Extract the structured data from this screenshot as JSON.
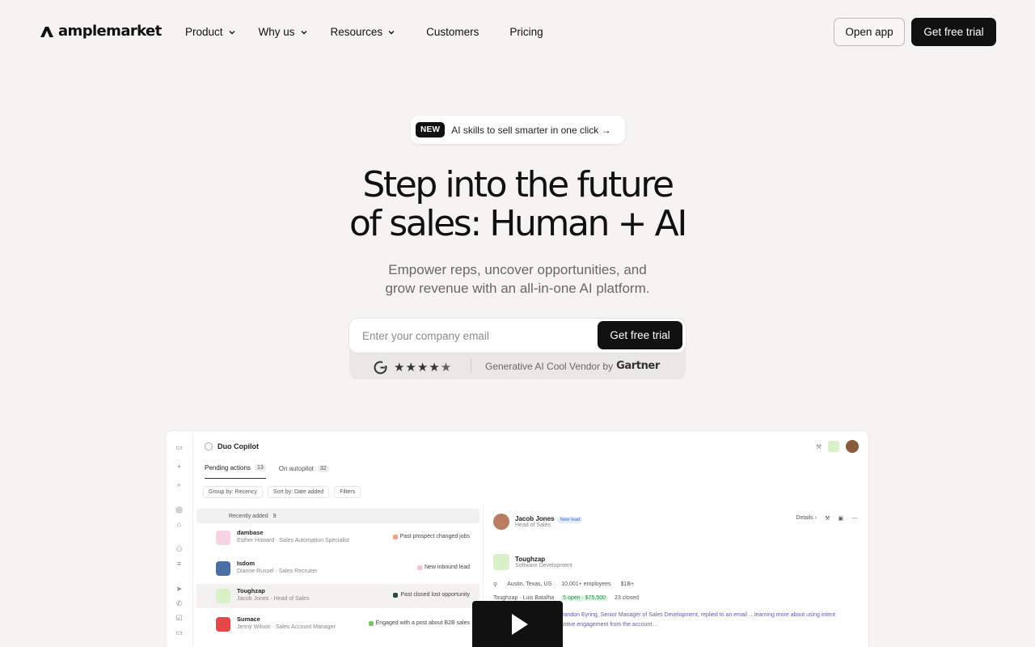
{
  "nav": {
    "logo_text": "amplemarket",
    "items": [
      {
        "label": "Product",
        "has_dropdown": true
      },
      {
        "label": "Why us",
        "has_dropdown": true
      },
      {
        "label": "Resources",
        "has_dropdown": true
      },
      {
        "label": "Customers",
        "has_dropdown": false
      },
      {
        "label": "Pricing",
        "has_dropdown": false
      }
    ],
    "open_app_label": "Open app",
    "trial_label": "Get free trial"
  },
  "announcement": {
    "badge": "NEW",
    "text": "AI skills to sell smarter in one click →"
  },
  "hero": {
    "title_line1": "Step into the future",
    "title_line2": "of sales: Human + AI",
    "subtitle_line1": "Empower reps, uncover opportunities, and",
    "subtitle_line2": "grow revenue with an all-in-one AI platform."
  },
  "signup": {
    "email_placeholder": "Enter your company email",
    "email_value": "",
    "submit_label": "Get free trial",
    "rating_stars": 4.5,
    "award_text": "Generative AI Cool Vendor by",
    "award_brand": "Gartner"
  },
  "app_preview": {
    "title": "Duo Copilot",
    "tabs": [
      {
        "label": "Pending actions",
        "count": "13"
      },
      {
        "label": "On autopilot",
        "count": "32"
      }
    ],
    "filters": [
      "Group by: Recency",
      "Sort by: Date added",
      "Filters"
    ],
    "group_label": "Recently added",
    "group_count": "9",
    "rows": [
      {
        "name": "dambase",
        "desc": "Esther Howard · Sales Automation Specialist",
        "event": "Past prospect changed jobs",
        "color": "#f3a48a"
      },
      {
        "name": "Isdom",
        "desc": "Dianne Russel · Sales Recruiter",
        "event": "New inbound lead",
        "color": "#f6c3cf"
      },
      {
        "name": "Toughzap",
        "desc": "Jacob Jones · Head of Sales",
        "event": "Past closed lost opportunity",
        "color": "#2b4d3a"
      },
      {
        "name": "Sumace",
        "desc": "Jenny Wilson · Sales Account Manager",
        "event": "Engaged with a post about B2B sales",
        "color": "#7cc36b"
      }
    ],
    "detail": {
      "person_name": "Jacob Jones",
      "person_badge": "New lead",
      "person_role": "Head of Sales",
      "details_label": "Details",
      "company_name": "Toughzap",
      "company_industry": "Software Development",
      "location": "Austin, Texas, US",
      "employees": "10,001+ employees",
      "revenue": "$1B+",
      "owner_line": "Toughzap · Luis Batalha",
      "opportunity": "5 open · $75,500",
      "closed": "23 closed",
      "summary": "…t data. Six months ago, Brandon Eyring, Senior Manager of Sales Development, replied to an email …learning more about using intent data. This is the only substantive engagement from the account…"
    }
  }
}
